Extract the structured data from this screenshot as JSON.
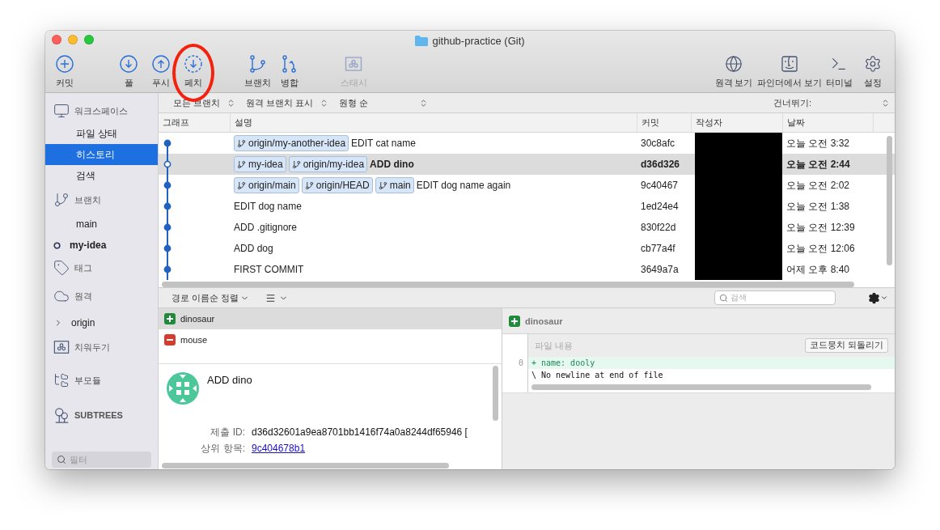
{
  "window": {
    "title": "github-practice (Git)"
  },
  "toolbar": {
    "groups": [
      {
        "items": [
          {
            "label": "커밋",
            "disabled": false,
            "annotated": false
          }
        ]
      },
      {
        "items": [
          {
            "label": "풀",
            "disabled": false,
            "annotated": false
          },
          {
            "label": "푸시",
            "disabled": false,
            "annotated": false
          },
          {
            "label": "페치",
            "disabled": false,
            "annotated": true
          }
        ]
      },
      {
        "items": [
          {
            "label": "브랜치",
            "disabled": false,
            "annotated": false
          },
          {
            "label": "병합",
            "disabled": false,
            "annotated": false
          }
        ]
      },
      {
        "items": [
          {
            "label": "스태시",
            "disabled": true,
            "annotated": false
          }
        ]
      }
    ],
    "right": [
      {
        "label": "원격 보기"
      },
      {
        "label": "파인더에서 보기"
      },
      {
        "label": "터미널"
      },
      {
        "label": "설정"
      }
    ]
  },
  "sidebar": {
    "sections": [
      {
        "title": "워크스페이스",
        "items": [
          {
            "label": "파일 상태",
            "selected": false,
            "current": false,
            "expandable": false
          },
          {
            "label": "히스토리",
            "selected": true,
            "current": false,
            "expandable": false
          },
          {
            "label": "검색",
            "selected": false,
            "current": false,
            "expandable": false
          }
        ]
      },
      {
        "title": "브랜치",
        "items": [
          {
            "label": "main",
            "selected": false,
            "current": false,
            "expandable": false
          },
          {
            "label": "my-idea",
            "selected": false,
            "current": true,
            "expandable": false
          }
        ]
      },
      {
        "title": "태그"
      },
      {
        "title": "원격",
        "items": [
          {
            "label": "origin",
            "selected": false,
            "current": false,
            "expandable": true
          }
        ]
      },
      {
        "title": "치워두기"
      },
      {
        "title": "부모듈"
      },
      {
        "title": "SUBTREES"
      }
    ],
    "filter_placeholder": "필터"
  },
  "filter_bar": {
    "selectors": [
      {
        "label": "모든 브랜치"
      },
      {
        "label": "원격 브랜치 표시"
      },
      {
        "label": "원형 순"
      }
    ],
    "skip_label": "건너뛰기:"
  },
  "history": {
    "columns": [
      "그래프",
      "설명",
      "커밋",
      "작성자",
      "날짜"
    ],
    "author_redacted": true,
    "rows": [
      {
        "refs": [
          "origin/my-another-idea"
        ],
        "message": "EDIT cat name",
        "commit": "30c8afc",
        "date": "오늘 오전 3:32",
        "selected": false,
        "current": false
      },
      {
        "refs": [
          "my-idea",
          "origin/my-idea"
        ],
        "message": "ADD dino",
        "commit": "d36d326",
        "date": "오늘 오전 2:44",
        "selected": true,
        "current": true
      },
      {
        "refs": [
          "origin/main",
          "origin/HEAD",
          "main"
        ],
        "message": "EDIT dog name again",
        "commit": "9c40467",
        "date": "오늘 오전 2:02",
        "selected": false,
        "current": false
      },
      {
        "refs": [],
        "message": "EDIT dog name",
        "commit": "1ed24e4",
        "date": "오늘 오전 1:38",
        "selected": false,
        "current": false
      },
      {
        "refs": [],
        "message": "ADD .gitignore",
        "commit": "830f22d",
        "date": "오늘 오전 12:39",
        "selected": false,
        "current": false
      },
      {
        "refs": [],
        "message": "ADD dog",
        "commit": "cb77a4f",
        "date": "오늘 오전 12:06",
        "selected": false,
        "current": false
      },
      {
        "refs": [],
        "message": "FIRST COMMIT",
        "commit": "3649a7a",
        "date": "어제 오후 8:40",
        "selected": false,
        "current": false
      }
    ]
  },
  "file_toolbar": {
    "sort_label": "경로 이름순 정렬",
    "search_placeholder": "검색"
  },
  "files": [
    {
      "name": "dinosaur",
      "kind": "added",
      "selected": true
    },
    {
      "name": "mouse",
      "kind": "removed",
      "selected": false
    }
  ],
  "commit_detail": {
    "message": "ADD dino",
    "fields": [
      {
        "label": "제출 ID:",
        "value": "d36d32601a9ea8701bb1416f74a0a8244df65946 [",
        "kind": "text"
      },
      {
        "label": "상위 항목:",
        "value": "9c404678b1",
        "kind": "link"
      }
    ]
  },
  "diff": {
    "file": {
      "name": "dinosaur",
      "kind": "added"
    },
    "hunk_title": "파일 내용",
    "revert_label": "코드뭉치 되돌리기",
    "lines": [
      {
        "number": "0",
        "marker": "+",
        "text": "name: dooly",
        "kind": "added"
      },
      {
        "marker": "\\",
        "text": "No newline at end of file",
        "kind": "note"
      }
    ]
  }
}
